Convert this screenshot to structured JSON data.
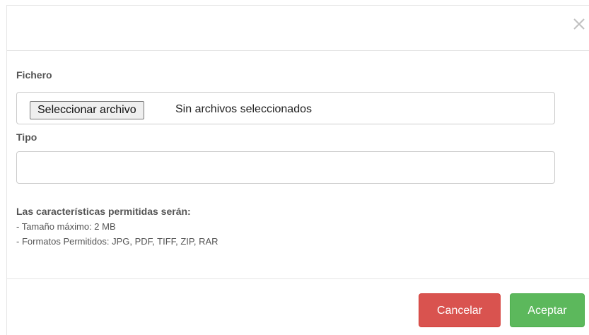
{
  "dialog": {
    "close_label": "×"
  },
  "form": {
    "file_label": "Fichero",
    "file_button_label": "Seleccionar archivo",
    "file_status": "Sin archivos seleccionados",
    "type_label": "Tipo",
    "type_value": "",
    "type_placeholder": ""
  },
  "info": {
    "title": "Las características permitidas serán:",
    "lines": [
      "- Tamaño máximo: 2 MB",
      "- Formatos Permitidos: JPG, PDF, TIFF, ZIP, RAR"
    ]
  },
  "footer": {
    "cancel_label": "Cancelar",
    "accept_label": "Aceptar"
  },
  "colors": {
    "cancel": "#d9534f",
    "accept": "#5cb85c",
    "label": "#555555",
    "border": "#cccccc"
  },
  "icons": {
    "close": "close-icon"
  }
}
